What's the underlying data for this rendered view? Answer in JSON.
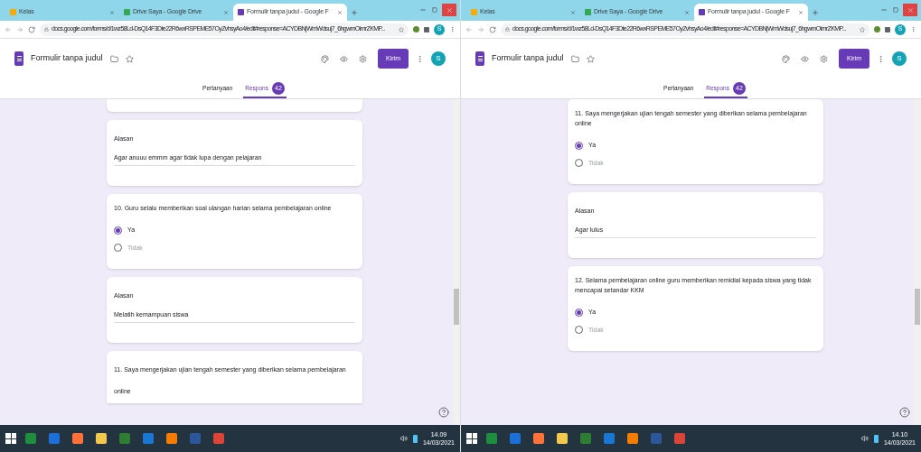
{
  "panes": [
    {
      "browser_tabs": [
        {
          "title": "Kelas",
          "selected": false
        },
        {
          "title": "Drive Saya - Google Drive",
          "selected": false
        },
        {
          "title": "Formulir tanpa judul - Google F",
          "selected": true
        }
      ],
      "url": "docs.google.com/forms/d/1wz58Ld-DsQ14F3Dte22R6wxRSPEME57OyZvhsyAo4/edit#response=ACYDBNjWmWdsuj7_6hgwmOimrZKMP...",
      "form_title": "Formulir tanpa judul",
      "send_label": "Kirim",
      "avatar": "S",
      "header_avatar": "S",
      "view_tabs": [
        {
          "label": "Pertanyaan",
          "selected": false
        },
        {
          "label": "Respons",
          "selected": true,
          "badge": "42"
        }
      ],
      "cards": [
        {
          "kind": "stub"
        },
        {
          "kind": "text",
          "label": "Alasan",
          "answer": "Agar anuuu emmm agar tidak lupa dengan pelajaran"
        },
        {
          "kind": "choice",
          "question": "10. Guru selalu memberikan soal ulangan harian selama pembelajaran online",
          "options": [
            {
              "label": "Ya",
              "selected": true
            },
            {
              "label": "Tidak",
              "selected": false
            }
          ]
        },
        {
          "kind": "text",
          "label": "Alasan",
          "answer": "Melatih kemampuan siswa"
        },
        {
          "kind": "heading",
          "question": "11. Saya mengerjakan ujian tengah semester yang diberikan selama pembelajaran online"
        }
      ],
      "clock": {
        "time": "14.09",
        "date": "14/03/2021"
      }
    },
    {
      "browser_tabs": [
        {
          "title": "Kelas",
          "selected": false
        },
        {
          "title": "Drive Saya - Google Drive",
          "selected": false
        },
        {
          "title": "Formulir tanpa judul - Google F",
          "selected": true
        }
      ],
      "url": "docs.google.com/forms/d/1wz58Ld-DsQ14F3Dte22R6wxRSPEME57OyZvhsyAo4/edit#response=ACYDBNjWmWdsuj7_6hgwmOimrZKMP...",
      "form_title": "Formulir tanpa judul",
      "send_label": "Kirim",
      "avatar": "S",
      "header_avatar": "S",
      "view_tabs": [
        {
          "label": "Pertanyaan",
          "selected": false
        },
        {
          "label": "Respons",
          "selected": true,
          "badge": "42"
        }
      ],
      "cards": [
        {
          "kind": "choice",
          "question": "11. Saya mengerjakan ujian tengah semester yang diberikan selama pembelajaran online",
          "options": [
            {
              "label": "Ya",
              "selected": true
            },
            {
              "label": "Tidak",
              "selected": false
            }
          ]
        },
        {
          "kind": "text",
          "label": "Alasan",
          "answer": "Agar lulus"
        },
        {
          "kind": "choice",
          "question": "12. Selama pembelajaran online guru memberikan remidial kepada siswa yang tidak mencapai setandar KKM",
          "options": [
            {
              "label": "Ya",
              "selected": true
            },
            {
              "label": "Tidak",
              "selected": false
            }
          ]
        }
      ],
      "clock": {
        "time": "14.10",
        "date": "14/03/2021"
      }
    }
  ]
}
